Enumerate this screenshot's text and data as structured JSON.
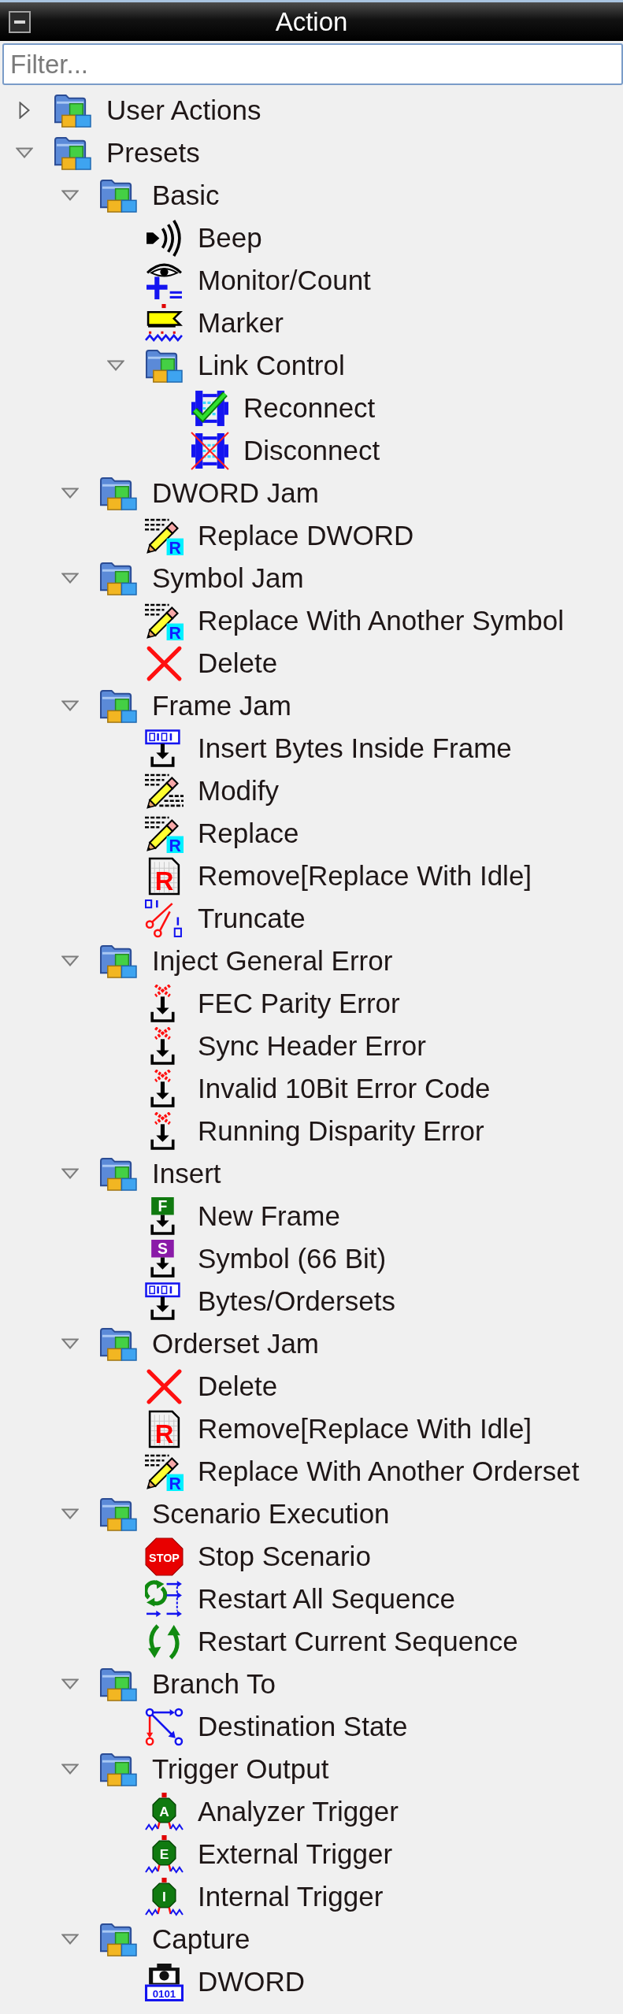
{
  "panel": {
    "title": "Action"
  },
  "filter": {
    "placeholder": "Filter..."
  },
  "tree": [
    {
      "label": "User Actions",
      "kind": "folder",
      "expanded": false
    },
    {
      "label": "Presets",
      "kind": "folder",
      "expanded": true,
      "children": [
        {
          "label": "Basic",
          "kind": "folder",
          "expanded": true,
          "children": [
            {
              "label": "Beep",
              "kind": "beep"
            },
            {
              "label": "Monitor/Count",
              "kind": "monitor"
            },
            {
              "label": "Marker",
              "kind": "marker"
            },
            {
              "label": "Link Control",
              "kind": "folder",
              "expanded": true,
              "children": [
                {
                  "label": "Reconnect",
                  "kind": "reconnect"
                },
                {
                  "label": "Disconnect",
                  "kind": "disconnect"
                }
              ]
            }
          ]
        },
        {
          "label": "DWORD Jam",
          "kind": "folder",
          "expanded": true,
          "children": [
            {
              "label": "Replace DWORD",
              "kind": "replace",
              "glyph": "R"
            }
          ]
        },
        {
          "label": "Symbol Jam",
          "kind": "folder",
          "expanded": true,
          "children": [
            {
              "label": "Replace With Another Symbol",
              "kind": "replace",
              "glyph": "R"
            },
            {
              "label": "Delete",
              "kind": "delete"
            }
          ]
        },
        {
          "label": "Frame Jam",
          "kind": "folder",
          "expanded": true,
          "children": [
            {
              "label": "Insert Bytes Inside Frame",
              "kind": "bytes"
            },
            {
              "label": "Modify",
              "kind": "modify"
            },
            {
              "label": "Replace",
              "kind": "replace",
              "glyph": "R"
            },
            {
              "label": "Remove[Replace With Idle]",
              "kind": "remove",
              "glyph": "R"
            },
            {
              "label": "Truncate",
              "kind": "truncate"
            }
          ]
        },
        {
          "label": "Inject General Error",
          "kind": "folder",
          "expanded": true,
          "children": [
            {
              "label": "FEC Parity Error",
              "kind": "error"
            },
            {
              "label": "Sync Header Error",
              "kind": "error"
            },
            {
              "label": "Invalid 10Bit Error Code",
              "kind": "error"
            },
            {
              "label": "Running Disparity Error",
              "kind": "error"
            }
          ]
        },
        {
          "label": "Insert",
          "kind": "folder",
          "expanded": true,
          "children": [
            {
              "label": "New Frame",
              "kind": "frame",
              "glyph": "F"
            },
            {
              "label": "Symbol (66 Bit)",
              "kind": "symbol",
              "glyph": "S"
            },
            {
              "label": "Bytes/Ordersets",
              "kind": "bytes"
            }
          ]
        },
        {
          "label": "Orderset Jam",
          "kind": "folder",
          "expanded": true,
          "children": [
            {
              "label": "Delete",
              "kind": "delete"
            },
            {
              "label": "Remove[Replace With Idle]",
              "kind": "remove",
              "glyph": "R"
            },
            {
              "label": "Replace With Another Orderset",
              "kind": "replace",
              "glyph": "R"
            }
          ]
        },
        {
          "label": "Scenario Execution",
          "kind": "folder",
          "expanded": true,
          "children": [
            {
              "label": "Stop Scenario",
              "kind": "stop",
              "glyph": "STOP"
            },
            {
              "label": "Restart All Sequence",
              "kind": "restartall"
            },
            {
              "label": "Restart Current Sequence",
              "kind": "restart"
            }
          ]
        },
        {
          "label": "Branch To",
          "kind": "folder",
          "expanded": true,
          "children": [
            {
              "label": "Destination State",
              "kind": "branch"
            }
          ]
        },
        {
          "label": "Trigger Output",
          "kind": "folder",
          "expanded": true,
          "children": [
            {
              "label": "Analyzer Trigger",
              "kind": "trigger",
              "glyph": "A"
            },
            {
              "label": "External Trigger",
              "kind": "trigger",
              "glyph": "E"
            },
            {
              "label": "Internal Trigger",
              "kind": "trigger",
              "glyph": "I"
            }
          ]
        },
        {
          "label": "Capture",
          "kind": "folder",
          "expanded": true,
          "children": [
            {
              "label": "DWORD",
              "kind": "capture",
              "glyph": "0101"
            }
          ]
        }
      ]
    }
  ]
}
